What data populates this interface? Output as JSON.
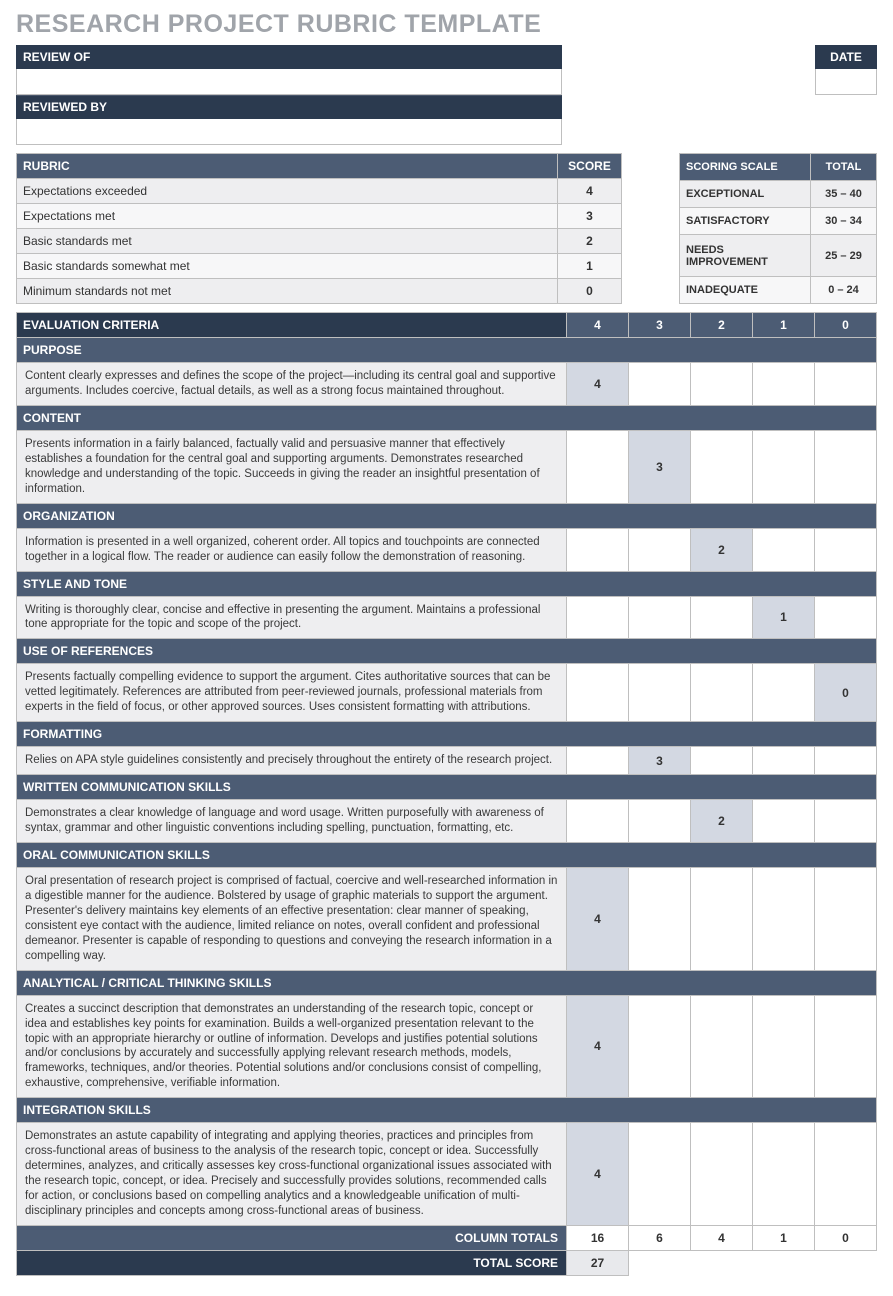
{
  "title": "RESEARCH PROJECT RUBRIC TEMPLATE",
  "header": {
    "review_of_label": "REVIEW OF",
    "reviewed_by_label": "REVIEWED BY",
    "date_label": "DATE"
  },
  "rubric": {
    "header": "RUBRIC",
    "score_header": "SCORE",
    "rows": [
      {
        "label": "Expectations exceeded",
        "score": "4"
      },
      {
        "label": "Expectations met",
        "score": "3"
      },
      {
        "label": "Basic standards met",
        "score": "2"
      },
      {
        "label": "Basic standards somewhat met",
        "score": "1"
      },
      {
        "label": "Minimum standards not met",
        "score": "0"
      }
    ]
  },
  "scale": {
    "header": "SCORING SCALE",
    "total_header": "TOTAL",
    "rows": [
      {
        "label": "EXCEPTIONAL",
        "range": "35 – 40"
      },
      {
        "label": "SATISFACTORY",
        "range": "30 – 34"
      },
      {
        "label": "NEEDS IMPROVEMENT",
        "range": "25 – 29"
      },
      {
        "label": "INADEQUATE",
        "range": "0 – 24"
      }
    ]
  },
  "criteria": {
    "header": "EVALUATION CRITERIA",
    "columns": [
      "4",
      "3",
      "2",
      "1",
      "0"
    ],
    "sections": [
      {
        "name": "PURPOSE",
        "desc": "Content clearly expresses and defines the scope of the project—including its central goal and supportive arguments. Includes coercive, factual details, as well as a strong focus maintained throughout.",
        "score_col": 0,
        "score_val": "4"
      },
      {
        "name": "CONTENT",
        "desc": "Presents information in a fairly balanced, factually valid and persuasive manner that effectively establishes a foundation for the central goal and supporting arguments. Demonstrates researched knowledge and understanding of the topic. Succeeds in giving the reader an insightful presentation of information.",
        "score_col": 1,
        "score_val": "3"
      },
      {
        "name": "ORGANIZATION",
        "desc": "Information is presented in a well organized, coherent order. All topics and touchpoints are connected together in a logical flow. The reader or audience can easily follow the demonstration of reasoning.",
        "score_col": 2,
        "score_val": "2"
      },
      {
        "name": "STYLE AND TONE",
        "desc": "Writing is thoroughly clear, concise and effective in presenting the argument. Maintains a professional tone appropriate for the topic and scope of the project.",
        "score_col": 3,
        "score_val": "1"
      },
      {
        "name": "USE OF REFERENCES",
        "desc": "Presents factually compelling evidence to support the argument. Cites authoritative sources that can be vetted legitimately. References are attributed from peer-reviewed journals, professional materials from experts in the field of focus, or other approved sources. Uses consistent formatting with attributions.",
        "score_col": 4,
        "score_val": "0"
      },
      {
        "name": "FORMATTING",
        "desc": "Relies on APA style guidelines consistently and precisely throughout the entirety of the research project.",
        "score_col": 1,
        "score_val": "3"
      },
      {
        "name": "WRITTEN COMMUNICATION SKILLS",
        "desc": "Demonstrates a clear knowledge of language and word usage. Written purposefully with awareness of syntax, grammar and other linguistic conventions including spelling, punctuation, formatting, etc.",
        "score_col": 2,
        "score_val": "2"
      },
      {
        "name": "ORAL COMMUNICATION SKILLS",
        "desc": "Oral presentation of research project is comprised of factual, coercive and well-researched information in a digestible manner for the audience. Bolstered by usage of graphic materials to support the argument. Presenter's delivery maintains key elements of an effective presentation: clear manner of speaking, consistent eye contact with the audience, limited reliance on notes, overall confident and professional demeanor. Presenter is capable of responding to questions and conveying the research information in a compelling way.",
        "score_col": 0,
        "score_val": "4"
      },
      {
        "name": "ANALYTICAL / CRITICAL THINKING SKILLS",
        "desc": "Creates a succinct description that demonstrates an understanding of the research topic, concept or idea and establishes key points for examination. Builds a well-organized presentation relevant to the topic with an appropriate hierarchy or outline of information. Develops and justifies potential solutions and/or conclusions by accurately and successfully applying relevant research methods, models, frameworks, techniques, and/or theories. Potential solutions and/or conclusions consist of compelling, exhaustive, comprehensive, verifiable information.",
        "score_col": 0,
        "score_val": "4"
      },
      {
        "name": "INTEGRATION SKILLS",
        "desc": "Demonstrates an astute capability of integrating and applying theories, practices and principles from cross-functional areas of business to the analysis of the research topic, concept or idea. Successfully determines, analyzes, and critically assesses key cross-functional organizational issues associated with the research topic, concept, or idea. Precisely and successfully provides solutions, recommended calls for action, or conclusions based on compelling  analytics and a knowledgeable unification of multi-disciplinary principles and concepts among cross-functional areas of business.",
        "score_col": 0,
        "score_val": "4"
      }
    ],
    "column_totals_label": "COLUMN TOTALS",
    "column_totals": [
      "16",
      "6",
      "4",
      "1",
      "0"
    ],
    "total_score_label": "TOTAL SCORE",
    "total_score": "27"
  }
}
